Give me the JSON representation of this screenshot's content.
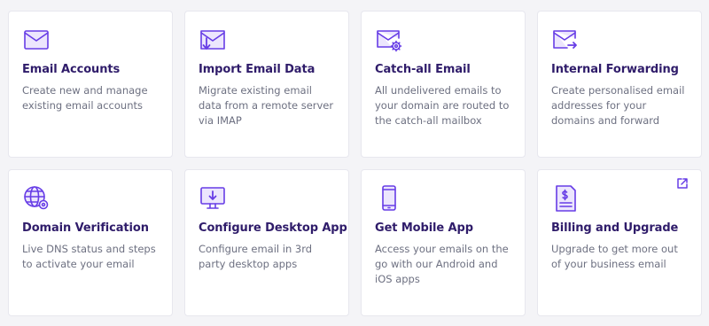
{
  "colors": {
    "accent": "#673de6",
    "title": "#2f1c6a",
    "text": "#6d7081",
    "card_bg": "#ffffff",
    "page_bg": "#f4f4f7"
  },
  "cards": [
    {
      "icon": "envelope-icon",
      "title": "Email Accounts",
      "description": "Create new and manage existing email accounts"
    },
    {
      "icon": "import-email-icon",
      "title": "Import Email Data",
      "description": "Migrate existing email data from a remote server via IMAP"
    },
    {
      "icon": "email-settings-icon",
      "title": "Catch-all Email",
      "description": "All undelivered emails to your domain are routed to the catch-all mailbox"
    },
    {
      "icon": "email-forward-icon",
      "title": "Internal Forwarding",
      "description": "Create personalised email addresses for your domains and forward"
    },
    {
      "icon": "globe-settings-icon",
      "title": "Domain Verification",
      "description": "Live DNS status and steps to activate your email"
    },
    {
      "icon": "desktop-download-icon",
      "title": "Configure Desktop App",
      "description": "Configure email in 3rd party desktop apps"
    },
    {
      "icon": "mobile-phone-icon",
      "title": "Get Mobile App",
      "description": "Access your emails on the go with our Android and iOS apps"
    },
    {
      "icon": "billing-document-icon",
      "title": "Billing and Upgrade",
      "description": "Upgrade to get more out of your business email",
      "external_link_icon": "external-link-icon"
    }
  ]
}
